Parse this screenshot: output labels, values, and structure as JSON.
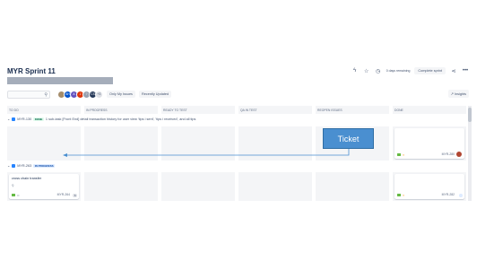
{
  "sprint": {
    "title": "MYR Sprint 11"
  },
  "header": {
    "days_remaining": "0 days remaining",
    "complete_label": "Complete sprint"
  },
  "toolbar": {
    "avatars": [
      {
        "initials": "",
        "color": "#a58d6b"
      },
      {
        "initials": "AH",
        "color": "#0052cc"
      },
      {
        "initials": "A",
        "color": "#6554c0"
      },
      {
        "initials": "J",
        "color": "#de350b"
      },
      {
        "initials": "?",
        "color": "#97a0af"
      },
      {
        "initials": "CS",
        "color": "#253858"
      },
      {
        "initials": "+3",
        "color": "#dfe1e6"
      }
    ],
    "only_my_issues": "Only My Issues",
    "recently_updated": "Recently Updated",
    "insights": "Insights"
  },
  "columns": [
    "TO DO",
    "IN PROGRESS",
    "READY TO TEST",
    "QA IN TEST",
    "REOPEN ISSUES",
    "DONE"
  ],
  "swimlanes": [
    {
      "key": "MYR-130",
      "status": "DONE",
      "summary": "1 sub-task  [Front End] detail transaction history for user view 'tips i sent', 'tips i received', and all tips",
      "cards": [
        {
          "column": 5,
          "key": "MYR-280"
        }
      ]
    },
    {
      "key": "MYR-263",
      "status": "IN PROGRESS",
      "summary": "",
      "cards": [
        {
          "column": 0,
          "text": "cross chain transfer",
          "key": "MYR-264",
          "estimate": "6"
        },
        {
          "column": 5,
          "key": "MYR-282"
        }
      ]
    }
  ],
  "overlay": {
    "label": "Ticket"
  },
  "colors": {
    "accent": "#0052cc",
    "done_green": "#006644",
    "progress_blue": "#0747a6"
  }
}
